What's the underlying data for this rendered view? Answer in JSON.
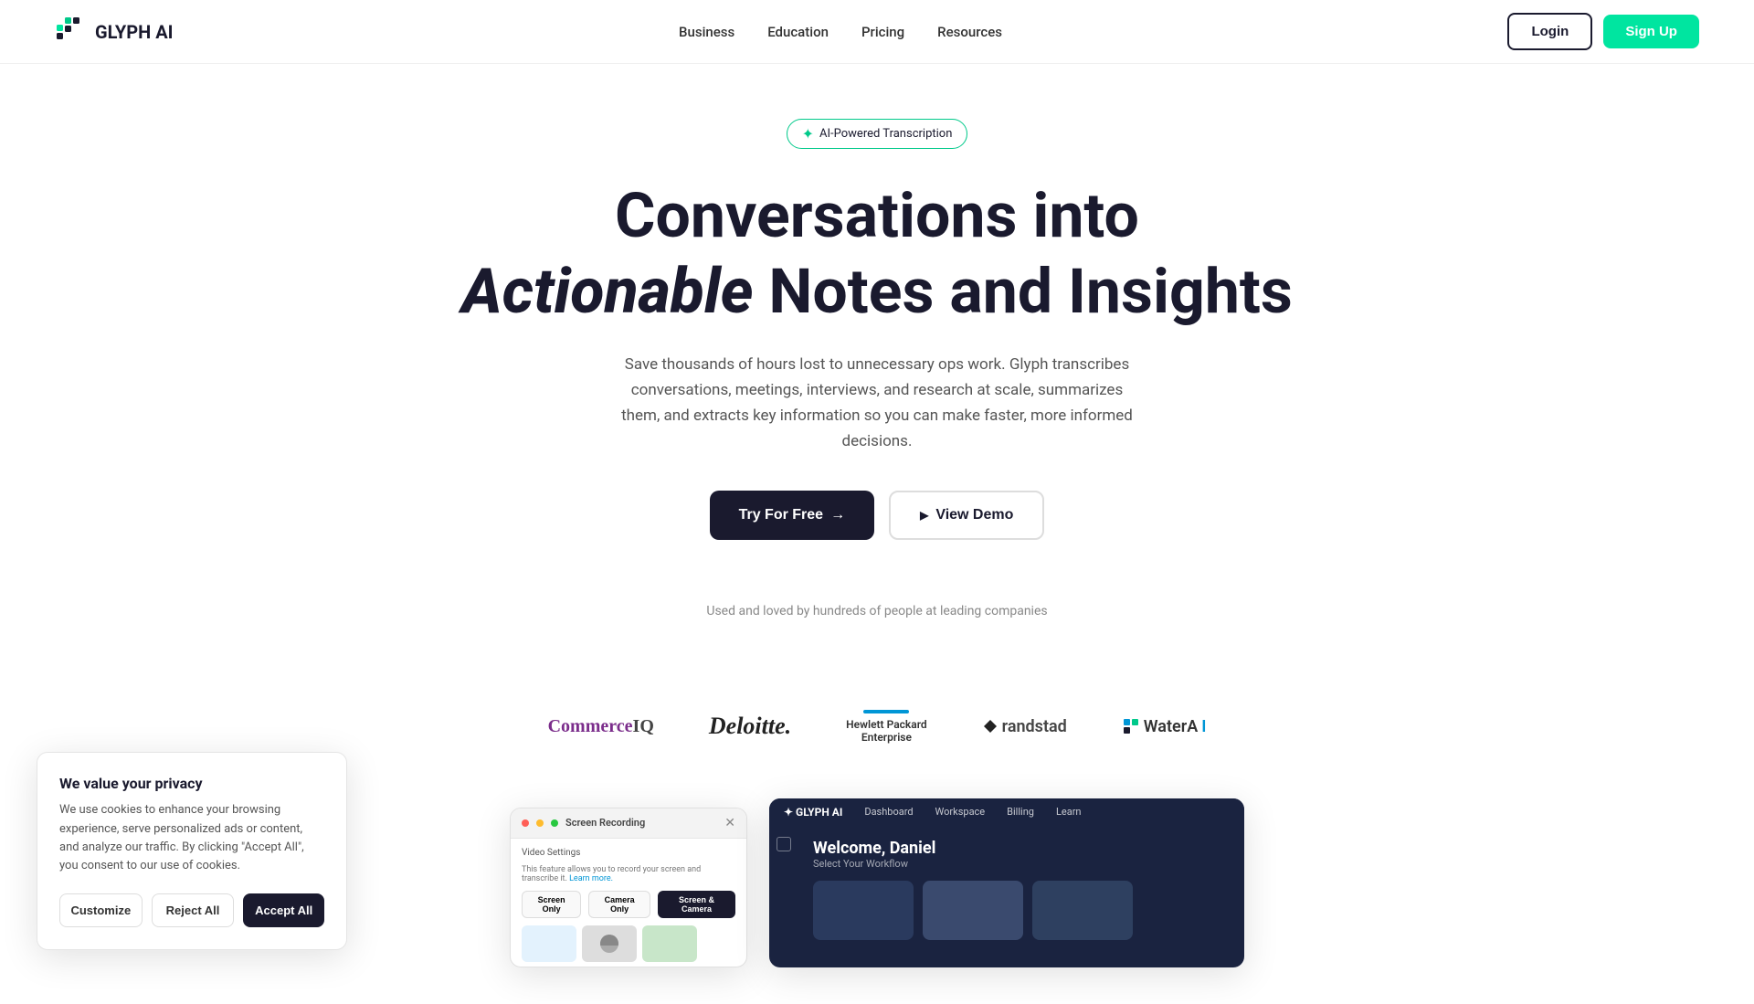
{
  "brand": {
    "name": "GLYPH AI",
    "logo_alt": "Glyph AI Logo"
  },
  "nav": {
    "links": [
      {
        "id": "business",
        "label": "Business"
      },
      {
        "id": "education",
        "label": "Education"
      },
      {
        "id": "pricing",
        "label": "Pricing"
      },
      {
        "id": "resources",
        "label": "Resources"
      }
    ],
    "login_label": "Login",
    "signup_label": "Sign Up"
  },
  "hero": {
    "badge": "AI-Powered Transcription",
    "headline_line1": "Conversations into",
    "headline_line2_bold": "Actionable",
    "headline_line2_rest": " Notes and Insights",
    "subtext": "Save thousands of hours lost to unnecessary ops work. Glyph transcribes conversations, meetings, interviews, and research at scale, summarizes them, and extracts key information so you can make faster, more informed decisions.",
    "cta_primary": "Try For Free",
    "cta_secondary": "View Demo",
    "trusted_text": "Used and loved by hundreds of people at leading companies"
  },
  "logos": [
    {
      "id": "commerceiq",
      "label": "CommerceIQ",
      "style": "commerce"
    },
    {
      "id": "deloitte",
      "label": "Deloitte.",
      "style": "deloitte"
    },
    {
      "id": "hp",
      "label": "Hewlett Packard Enterprise",
      "style": "hp"
    },
    {
      "id": "randstad",
      "label": "randstad",
      "style": "randstad"
    },
    {
      "id": "waterai",
      "label": "WaterA",
      "style": "water"
    }
  ],
  "cookie": {
    "title": "We value your privacy",
    "text": "We use cookies to enhance your browsing experience, serve personalized ads or content, and analyze our traffic. By clicking \"Accept All\", you consent to our use of cookies.",
    "customize_label": "Customize",
    "reject_label": "Reject All",
    "accept_label": "Accept All"
  },
  "mock_left": {
    "title": "Screen Recording",
    "setting_label": "Video Settings",
    "toggle_options": [
      "Screen Only",
      "Camera Only",
      "Screen & Camera"
    ]
  },
  "mock_right": {
    "welcome": "Welcome, Daniel",
    "subtitle": "Select Your Workflow"
  },
  "colors": {
    "accent_green": "#00e5a0",
    "dark": "#1a1a2e",
    "commerce_purple": "#7b2d8b"
  }
}
